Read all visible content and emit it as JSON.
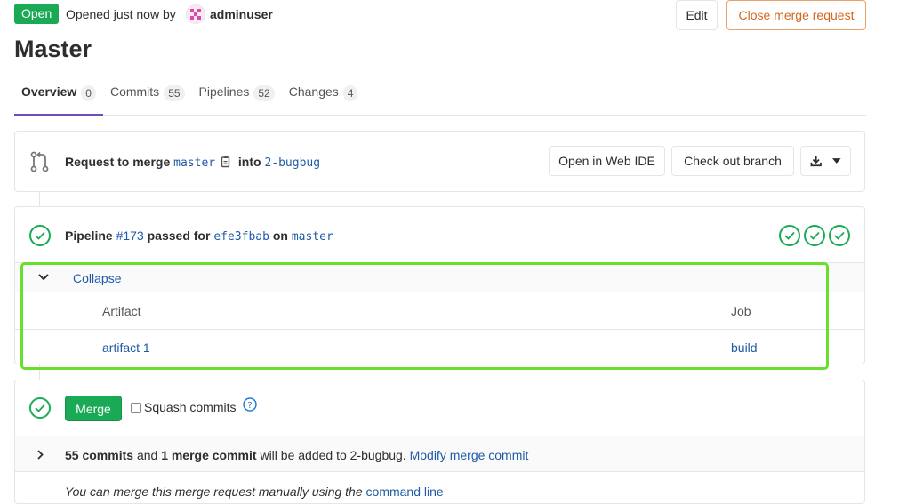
{
  "header": {
    "status": "Open",
    "opened_text": "Opened just now by",
    "author": "adminuser",
    "edit_label": "Edit",
    "close_label": "Close merge request",
    "title": "Master"
  },
  "tabs": [
    {
      "label": "Overview",
      "count": "0"
    },
    {
      "label": "Commits",
      "count": "55"
    },
    {
      "label": "Pipelines",
      "count": "52"
    },
    {
      "label": "Changes",
      "count": "4"
    }
  ],
  "merge_info": {
    "prefix": "Request to merge",
    "source_branch": "master",
    "into": "into",
    "target_branch": "2-bugbug",
    "web_ide_label": "Open in Web IDE",
    "checkout_label": "Check out branch"
  },
  "pipeline": {
    "label": "Pipeline",
    "id": "#173",
    "passed_for": "passed for",
    "commit": "efe3fbab",
    "on": "on",
    "branch": "master",
    "collapse_label": "Collapse",
    "artifact_header": "Artifact",
    "job_header": "Job",
    "artifact_name": "artifact 1",
    "job_name": "build"
  },
  "merge": {
    "button_label": "Merge",
    "squash_label": "Squash commits",
    "commits_count": "55 commits",
    "and": "and",
    "merge_commit": "1 merge commit",
    "will_be_added": "will be added to 2-bugbug.",
    "modify_label": "Modify merge commit",
    "manual_text": "You can merge this merge request manually using the",
    "command_line": "command line"
  },
  "colors": {
    "accent_green": "#1aaa55",
    "link_blue": "#1f5aa6",
    "close_orange": "#d4661f",
    "active_tab_underline": "#6b4fbb",
    "highlight_green": "#6ade2c"
  }
}
